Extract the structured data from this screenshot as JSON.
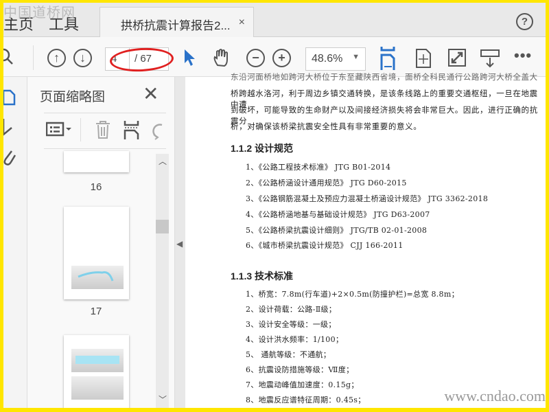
{
  "watermark": "中国道桥网",
  "tabs": {
    "home": "主页",
    "tools": "工具",
    "document": "拱桥抗震计算报告2...",
    "close": "×",
    "help": "?"
  },
  "toolbar": {
    "page_current": "4",
    "page_total": "/ 67",
    "zoom": "48.6%"
  },
  "panel": {
    "title": "页面缩略图",
    "thumbnails": [
      {
        "page": "16"
      },
      {
        "page": "17"
      },
      {
        "page": ""
      }
    ]
  },
  "document": {
    "intro_lines": [
      "东沿河面桥地如跨河大桥位于东至藏陕西省境，面桥全科民通行公路跨河大桥全盖大",
      "桥跨越水洛河，利于周边乡镇交通转换，是该条线路上的重要交通枢纽，一旦在地震中遭",
      "到破坏，可能导致的生命财产以及间接经济损失将会非常巨大。因此，进行正确的抗震分",
      "析，对确保该桥梁抗震安全性具有非常重要的意义。"
    ],
    "section_112": "1.1.2  设计规范",
    "codes": [
      "1、《公路工程技术标准》 JTG B01-2014",
      "2、《公路桥涵设计通用规范》 JTG D60-2015",
      "3、《公路钢筋混凝土及预应力混凝土桥涵设计规范》 JTG 3362-2018",
      "4、《公路桥涵地基与基础设计规范》 JTG D63-2007",
      "5、《公路桥梁抗震设计细则》 JTG/TB 02-01-2008",
      "6、《城市桥梁抗震设计规范》 CJJ 166-2011"
    ],
    "section_113": "1.1.3 技术标准",
    "standards": [
      "1、桥宽：7.8m(行车道)+2×0.5m(防撞护栏)=总宽 8.8m；",
      "2、设计荷载：公路-Ⅱ级；",
      "3、设计安全等级：一级；",
      "4、设计洪水频率：1/100；",
      "5、 通航等级：不通航；",
      "6、抗震设防措施等级：Ⅶ度；",
      "7、地震动峰值加速度：0.15g；",
      "8、地震反应谱特征周期：0.45s；"
    ]
  },
  "site_watermark": "www.cndao.com",
  "colors": {
    "frame": "#ffe600",
    "accent": "#2a72c9",
    "annotation": "#e02020"
  }
}
